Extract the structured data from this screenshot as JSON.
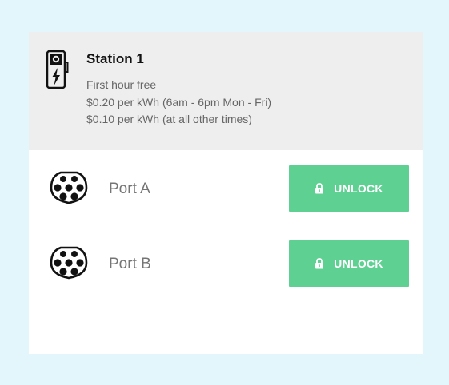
{
  "station": {
    "title": "Station 1",
    "icon": "ev-charging-station-icon",
    "pricing": [
      "First hour free",
      "$0.20 per kWh (6am - 6pm Mon - Fri)",
      "$0.10 per kWh (at all other times)"
    ]
  },
  "ports": [
    {
      "label": "Port A",
      "icon": "ev-connector-icon",
      "button_label": "UNLOCK",
      "button_icon": "lock-icon"
    },
    {
      "label": "Port B",
      "icon": "ev-connector-icon",
      "button_label": "UNLOCK",
      "button_icon": "lock-icon"
    }
  ],
  "colors": {
    "background": "#e3f6fc",
    "header_background": "#eeeeee",
    "button": "#5dd092",
    "button_text": "#ffffff"
  }
}
